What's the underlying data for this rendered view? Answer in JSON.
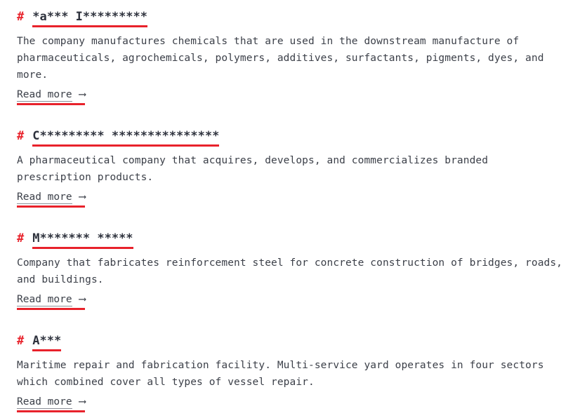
{
  "theme": {
    "background": "#ffffff",
    "accent": "#e8222b",
    "text": "#3c4049",
    "heading_text": "#2e323d",
    "underline": "#e8222b"
  },
  "list": {
    "hash_marker": "#",
    "read_more_label": "Read more",
    "read_more_arrow": "⟶",
    "entries": [
      {
        "title": "*a*** I*********",
        "description": "The company manufactures chemicals that are used in the downstream manufacture of pharmaceuticals, agrochemicals, polymers, additives, surfactants, pigments, dyes, and more.",
        "read_more": "Read more"
      },
      {
        "title": "C********* ***************",
        "description": "A pharmaceutical company that acquires, develops, and commercializes branded prescription products.",
        "read_more": "Read more"
      },
      {
        "title": "M******* *****",
        "description": "Company that fabricates reinforcement steel for concrete construction of bridges, roads, and buildings.",
        "read_more": "Read more"
      },
      {
        "title": "A***",
        "description": "Maritime repair and fabrication facility. Multi-service yard operates in four sectors which combined cover all types of vessel repair.",
        "read_more": "Read more"
      }
    ]
  }
}
